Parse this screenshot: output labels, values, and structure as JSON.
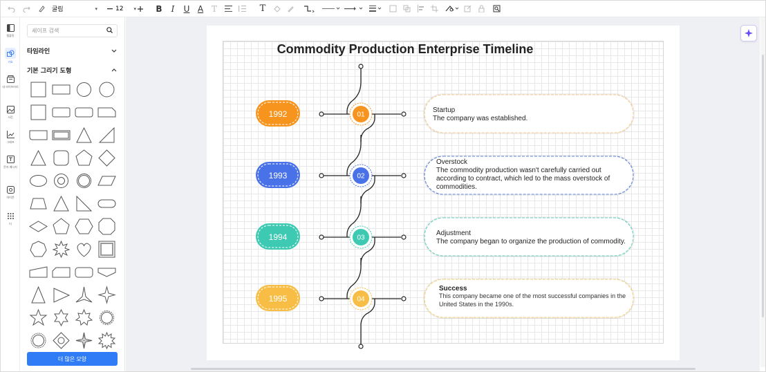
{
  "toolbar": {
    "font_name": "굴림",
    "font_size": "12",
    "icons": [
      "undo-icon",
      "redo-icon",
      "format-painter-icon",
      "bold-icon",
      "italic-icon",
      "underline-icon",
      "font-color-icon",
      "clear-format-icon",
      "align-icon",
      "spacing-icon",
      "text-icon",
      "fill-icon",
      "pen-icon",
      "connector-icon",
      "line-style-icon",
      "arrow-style-icon",
      "line-weight-icon",
      "group-icon",
      "layer-icon",
      "align-objects-icon",
      "crop-icon",
      "shape-style-icon",
      "edit-icon",
      "lock-icon",
      "find-icon"
    ]
  },
  "rail": [
    {
      "label": "템플릿",
      "icon": "template-icon"
    },
    {
      "label": "기호",
      "icon": "symbol-icon",
      "active": true
    },
    {
      "label": "내 라이브러리",
      "icon": "library-icon"
    },
    {
      "label": "사진",
      "icon": "image-icon"
    },
    {
      "label": "그래프",
      "icon": "chart-icon"
    },
    {
      "label": "문자 예시지",
      "icon": "text-sample-icon"
    },
    {
      "label": "아이콘",
      "icon": "icon-set-icon"
    },
    {
      "label": "더",
      "icon": "more-icon"
    }
  ],
  "panel": {
    "search_placeholder": "셰이프 검색",
    "section_timeline": "타임라인",
    "section_basic": "기본 그리기 도형",
    "more_button": "더 많은 모양"
  },
  "diagram": {
    "title": "Commodity Production Enterprise Timeline",
    "items": [
      {
        "year": "1992",
        "num": "01",
        "color": "#f7941d",
        "heading": "Startup",
        "heading_bold": false,
        "lines": [
          "The company was established."
        ],
        "border": "#f5c98a"
      },
      {
        "year": "1993",
        "num": "02",
        "color": "#4a72e8",
        "heading": "Overstock",
        "heading_bold": false,
        "lines": [
          "The commodity production wasn't carefully carried out",
          "according to contract, which led to the mass overstock of",
          "commodities."
        ],
        "border": "#5a7fd6"
      },
      {
        "year": "1994",
        "num": "03",
        "color": "#3ec9b3",
        "heading": "Adjustment",
        "heading_bold": false,
        "lines": [
          "The company began to organize the production of commodity."
        ],
        "border": "#5fcfbe"
      },
      {
        "year": "1995",
        "num": "04",
        "color": "#f7bd45",
        "heading": "Success",
        "heading_bold": true,
        "lines": [
          "This company became one of the most successful companies in the",
          "United States in the 1990s."
        ],
        "border": "#f5cf73"
      }
    ]
  }
}
